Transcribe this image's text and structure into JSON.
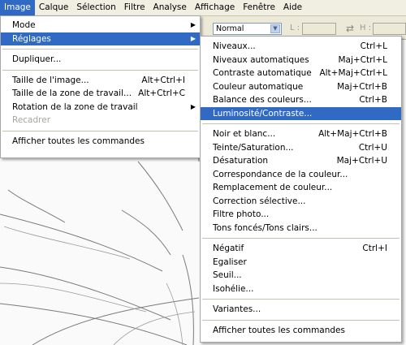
{
  "menubar": [
    "Image",
    "Calque",
    "Sélection",
    "Filtre",
    "Analyse",
    "Affichage",
    "Fenêtre",
    "Aide"
  ],
  "options": {
    "mode_value": "Normal",
    "l_label": "L :",
    "h_label": "H :"
  },
  "image_menu": {
    "items": [
      {
        "label": "Mode",
        "shortcut": "",
        "submenu": true
      },
      {
        "label": "Réglages",
        "shortcut": "",
        "submenu": true,
        "highlighted": true
      },
      {
        "label": "Dupliquer...",
        "shortcut": ""
      },
      {
        "label": "Taille de l'image...",
        "shortcut": "Alt+Ctrl+I"
      },
      {
        "label": "Taille de la zone de travail...",
        "shortcut": "Alt+Ctrl+C"
      },
      {
        "label": "Rotation de la zone de travail",
        "shortcut": "",
        "submenu": true
      },
      {
        "label": "Recadrer",
        "shortcut": "",
        "disabled": true
      },
      {
        "label": "Afficher toutes les commandes",
        "shortcut": ""
      }
    ]
  },
  "reglages_menu": {
    "items": [
      {
        "label": "Niveaux...",
        "shortcut": "Ctrl+L"
      },
      {
        "label": "Niveaux automatiques",
        "shortcut": "Maj+Ctrl+L"
      },
      {
        "label": "Contraste automatique",
        "shortcut": "Alt+Maj+Ctrl+L"
      },
      {
        "label": "Couleur automatique",
        "shortcut": "Maj+Ctrl+B"
      },
      {
        "label": "Balance des couleurs...",
        "shortcut": "Ctrl+B"
      },
      {
        "label": "Luminosité/Contraste...",
        "shortcut": "",
        "highlighted": true
      },
      {
        "label": "Noir et blanc...",
        "shortcut": "Alt+Maj+Ctrl+B"
      },
      {
        "label": "Teinte/Saturation...",
        "shortcut": "Ctrl+U"
      },
      {
        "label": "Désaturation",
        "shortcut": "Maj+Ctrl+U"
      },
      {
        "label": "Correspondance de la couleur...",
        "shortcut": ""
      },
      {
        "label": "Remplacement de couleur...",
        "shortcut": ""
      },
      {
        "label": "Correction sélective...",
        "shortcut": ""
      },
      {
        "label": "Filtre photo...",
        "shortcut": ""
      },
      {
        "label": "Tons foncés/Tons clairs...",
        "shortcut": ""
      },
      {
        "label": "Négatif",
        "shortcut": "Ctrl+I"
      },
      {
        "label": "Egaliser",
        "shortcut": ""
      },
      {
        "label": "Seuil...",
        "shortcut": ""
      },
      {
        "label": "Isohélie...",
        "shortcut": ""
      },
      {
        "label": "Variantes...",
        "shortcut": ""
      },
      {
        "label": "Afficher toutes les commandes",
        "shortcut": ""
      }
    ]
  },
  "colors": {
    "highlight": "#316ac5",
    "menu_bg": "#ffffff",
    "chrome": "#ece9d8"
  }
}
